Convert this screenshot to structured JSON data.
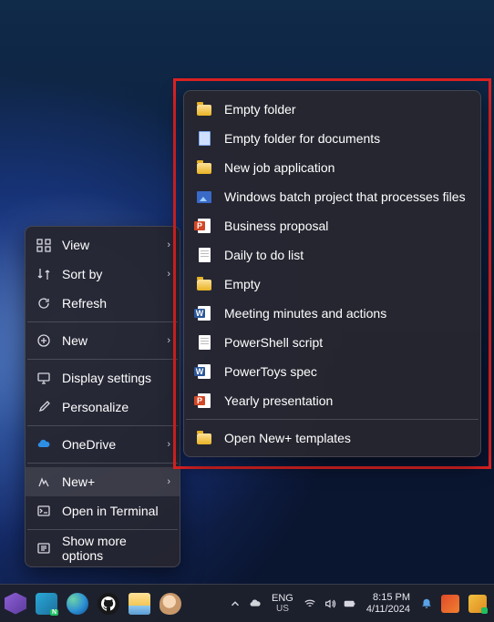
{
  "context_menu": {
    "items": [
      {
        "label": "View",
        "icon": "view",
        "has_submenu": true
      },
      {
        "label": "Sort by",
        "icon": "sort",
        "has_submenu": true
      },
      {
        "label": "Refresh",
        "icon": "refresh",
        "has_submenu": false
      }
    ],
    "items2": [
      {
        "label": "New",
        "icon": "plus",
        "has_submenu": true
      }
    ],
    "items3": [
      {
        "label": "Display settings",
        "icon": "display",
        "has_submenu": false
      },
      {
        "label": "Personalize",
        "icon": "brush",
        "has_submenu": false
      }
    ],
    "items4": [
      {
        "label": "OneDrive",
        "icon": "cloud",
        "has_submenu": true
      }
    ],
    "items5": [
      {
        "label": "New+",
        "icon": "newplus",
        "has_submenu": true,
        "highlighted": true
      },
      {
        "label": "Open in Terminal",
        "icon": "terminal",
        "has_submenu": false
      }
    ],
    "items6": [
      {
        "label": "Show more options",
        "icon": "more",
        "has_submenu": false
      }
    ]
  },
  "newplus_submenu": {
    "templates": [
      {
        "label": "Empty folder",
        "icon": "folder"
      },
      {
        "label": "Empty folder for documents",
        "icon": "docblue"
      },
      {
        "label": "New job application",
        "icon": "folder"
      },
      {
        "label": "Windows batch project that processes files",
        "icon": "image"
      },
      {
        "label": "Business proposal",
        "icon": "ppt"
      },
      {
        "label": "Daily to do list",
        "icon": "doc"
      },
      {
        "label": "Empty",
        "icon": "folder"
      },
      {
        "label": "Meeting minutes and actions",
        "icon": "word"
      },
      {
        "label": "PowerShell script",
        "icon": "doc"
      },
      {
        "label": "PowerToys spec",
        "icon": "word"
      },
      {
        "label": "Yearly presentation",
        "icon": "ppt"
      }
    ],
    "footer": {
      "label": "Open New+ templates",
      "icon": "folder"
    }
  },
  "taskbar": {
    "apps": [
      {
        "name": "visual-studio",
        "color": "#8e5ed6"
      },
      {
        "name": "powertoys-new",
        "color": "#2aa8d8"
      },
      {
        "name": "edge",
        "color": "#2c8fd4"
      },
      {
        "name": "github",
        "color": "#ffffff"
      },
      {
        "name": "file-explorer",
        "color": "#f3c24b"
      },
      {
        "name": "paint",
        "color": "#4aa8e0"
      }
    ],
    "tray": {
      "lang1": "ENG",
      "lang2": "US",
      "time": "8:15 PM",
      "date": "4/11/2024"
    }
  },
  "highlight_color": "#d22"
}
